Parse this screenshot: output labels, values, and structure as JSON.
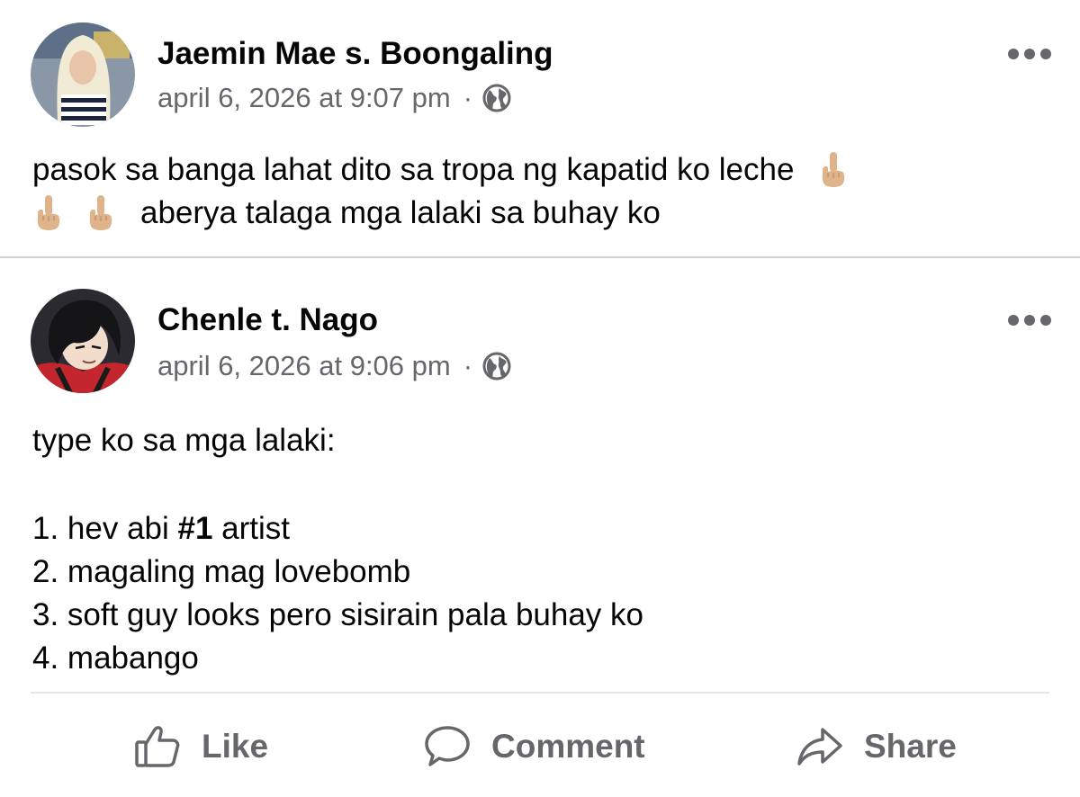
{
  "posts": [
    {
      "author": "Jaemin Mae s. Boongaling",
      "timestamp": "april 6, 2026 at 9:07 pm",
      "separator": "·",
      "privacy_icon": "globe-icon",
      "lines": [
        "pasok sa banga lahat dito sa tropa ng kapatid ko leche",
        "aberya talaga mga lalaki sa buhay ko"
      ],
      "emoji": "middle-finger-emoji"
    },
    {
      "author": "Chenle t. Nago",
      "timestamp": "april 6, 2026 at 9:06 pm",
      "separator": "·",
      "privacy_icon": "globe-icon",
      "intro": "type ko sa mga lalaki:",
      "list": {
        "item1_prefix": "1. hev abi ",
        "item1_bold": "#1",
        "item1_suffix": " artist",
        "item2": "2. magaling mag lovebomb",
        "item3": "3. soft guy looks pero sisirain pala buhay ko",
        "item4": "4. mabango"
      }
    }
  ],
  "actions": {
    "like": "Like",
    "comment": "Comment",
    "share": "Share"
  },
  "colors": {
    "text": "#050505",
    "secondary": "#65676b",
    "divider": "#cfcfd6"
  }
}
